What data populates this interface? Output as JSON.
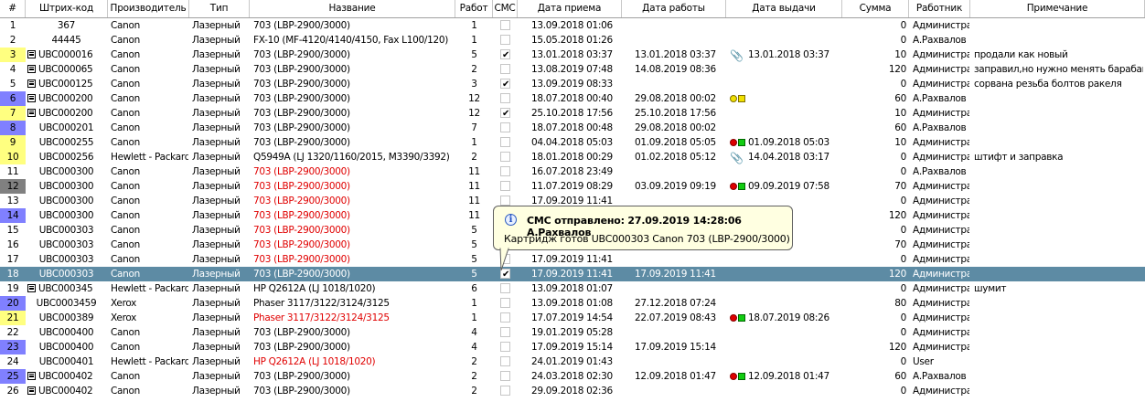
{
  "columns": [
    "#",
    "Штрих-код",
    "Производитель",
    "Тип",
    "Название",
    "Работ",
    "СМС",
    "Дата приема",
    "Дата работы",
    "Дата выдачи",
    "Сумма",
    "Работник",
    "Примечание"
  ],
  "colors": {
    "selected_row": "#5d8ba4",
    "num_yellow": "#ffff80",
    "num_blue": "#8080ff",
    "num_gray": "#808080",
    "red_text": "#e00000",
    "tooltip_bg": "#ffffe1"
  },
  "rows": [
    {
      "num": "1",
      "numbg": "",
      "tree": false,
      "barcode": "367",
      "maker": "Canon",
      "type": "Лазерный",
      "name": "703 (LBP-2900/3000)",
      "red": false,
      "work": "1",
      "sms": false,
      "received": "13.09.2018 01:06",
      "workdate": "",
      "status": "",
      "issued": "",
      "sum": "0",
      "worker": "Администра",
      "note": ""
    },
    {
      "num": "2",
      "numbg": "",
      "tree": false,
      "barcode": "44445",
      "maker": "Canon",
      "type": "Лазерный",
      "name": "FX-10 (MF-4120/4140/4150, Fax L100/120)",
      "red": false,
      "work": "1",
      "sms": false,
      "received": "15.05.2018 01:26",
      "workdate": "",
      "status": "",
      "issued": "",
      "sum": "0",
      "worker": "А.Рахвалов",
      "note": ""
    },
    {
      "num": "3",
      "numbg": "yellow",
      "tree": true,
      "barcode": "UBC000016",
      "maker": "Canon",
      "type": "Лазерный",
      "name": "703 (LBP-2900/3000)",
      "red": false,
      "work": "5",
      "sms": true,
      "received": "13.01.2018 03:37",
      "workdate": "13.01.2018 03:37",
      "status": "clip",
      "issued": "13.01.2018 03:37",
      "sum": "10",
      "worker": "Администра",
      "note": "продали как новый"
    },
    {
      "num": "4",
      "numbg": "",
      "tree": true,
      "barcode": "UBC000065",
      "maker": "Canon",
      "type": "Лазерный",
      "name": "703 (LBP-2900/3000)",
      "red": false,
      "work": "2",
      "sms": false,
      "received": "13.08.2019 07:48",
      "workdate": "14.08.2019 08:36",
      "status": "",
      "issued": "",
      "sum": "120",
      "worker": "Администра",
      "note": "заправил,но нужно менять барабан"
    },
    {
      "num": "5",
      "numbg": "",
      "tree": true,
      "barcode": "UBC000125",
      "maker": "Canon",
      "type": "Лазерный",
      "name": "703 (LBP-2900/3000)",
      "red": false,
      "work": "3",
      "sms": true,
      "received": "13.09.2019 08:33",
      "workdate": "",
      "status": "",
      "issued": "",
      "sum": "0",
      "worker": "Администра",
      "note": "сорвана резьба болтов ракеля"
    },
    {
      "num": "6",
      "numbg": "blue",
      "tree": true,
      "barcode": "UBC000200",
      "maker": "Canon",
      "type": "Лазерный",
      "name": "703 (LBP-2900/3000)",
      "red": false,
      "work": "12",
      "sms": false,
      "received": "18.07.2018 00:40",
      "workdate": "29.08.2018 00:02",
      "status": "yy",
      "issued": "",
      "sum": "60",
      "worker": "А.Рахвалов",
      "note": ""
    },
    {
      "num": "7",
      "numbg": "yellow",
      "tree": true,
      "barcode": "UBC000200",
      "maker": "Canon",
      "type": "Лазерный",
      "name": "703 (LBP-2900/3000)",
      "red": false,
      "work": "12",
      "sms": true,
      "received": "25.10.2018 17:56",
      "workdate": "25.10.2018 17:56",
      "status": "",
      "issued": "",
      "sum": "10",
      "worker": "Администра",
      "note": ""
    },
    {
      "num": "8",
      "numbg": "blue",
      "tree": false,
      "barcode": "UBC000201",
      "maker": "Canon",
      "type": "Лазерный",
      "name": "703 (LBP-2900/3000)",
      "red": false,
      "work": "7",
      "sms": false,
      "received": "18.07.2018 00:48",
      "workdate": "29.08.2018 00:02",
      "status": "",
      "issued": "",
      "sum": "60",
      "worker": "А.Рахвалов",
      "note": ""
    },
    {
      "num": "9",
      "numbg": "yellow",
      "tree": false,
      "barcode": "UBC000255",
      "maker": "Canon",
      "type": "Лазерный",
      "name": "703 (LBP-2900/3000)",
      "red": false,
      "work": "1",
      "sms": false,
      "received": "04.04.2018 05:03",
      "workdate": "01.09.2018 05:05",
      "status": "rg",
      "issued": "01.09.2018 05:03",
      "sum": "10",
      "worker": "Администра",
      "note": ""
    },
    {
      "num": "10",
      "numbg": "yellow",
      "tree": false,
      "barcode": "UBC000256",
      "maker": "Hewlett - Packard",
      "type": "Лазерный",
      "name": "Q5949A (LJ 1320/1160/2015, M3390/3392)",
      "red": false,
      "work": "2",
      "sms": false,
      "received": "18.01.2018 00:29",
      "workdate": "01.02.2018 05:12",
      "status": "clip",
      "issued": "14.04.2018 03:17",
      "sum": "0",
      "worker": "Администра",
      "note": "штифт и заправка"
    },
    {
      "num": "11",
      "numbg": "",
      "tree": false,
      "barcode": "UBC000300",
      "maker": "Canon",
      "type": "Лазерный",
      "name": "703 (LBP-2900/3000)",
      "red": true,
      "work": "11",
      "sms": false,
      "received": "16.07.2018 23:49",
      "workdate": "",
      "status": "",
      "issued": "",
      "sum": "0",
      "worker": "А.Рахвалов",
      "note": ""
    },
    {
      "num": "12",
      "numbg": "gray",
      "tree": false,
      "barcode": "UBC000300",
      "maker": "Canon",
      "type": "Лазерный",
      "name": "703 (LBP-2900/3000)",
      "red": true,
      "work": "11",
      "sms": false,
      "received": "11.07.2019 08:29",
      "workdate": "03.09.2019 09:19",
      "status": "rg",
      "issued": "09.09.2019 07:58",
      "sum": "70",
      "worker": "Администра",
      "note": ""
    },
    {
      "num": "13",
      "numbg": "",
      "tree": false,
      "barcode": "UBC000300",
      "maker": "Canon",
      "type": "Лазерный",
      "name": "703 (LBP-2900/3000)",
      "red": true,
      "work": "11",
      "sms": false,
      "received": "17.09.2019 11:41",
      "workdate": "",
      "status": "",
      "issued": "",
      "sum": "0",
      "worker": "Администра",
      "note": ""
    },
    {
      "num": "14",
      "numbg": "blue",
      "tree": false,
      "barcode": "UBC000300",
      "maker": "Canon",
      "type": "Лазерный",
      "name": "703 (LBP-2900/3000)",
      "red": true,
      "work": "11",
      "sms": false,
      "received": "",
      "workdate": "",
      "status": "",
      "issued": "",
      "sum": "120",
      "worker": "Администра",
      "note": ""
    },
    {
      "num": "15",
      "numbg": "",
      "tree": false,
      "barcode": "UBC000303",
      "maker": "Canon",
      "type": "Лазерный",
      "name": "703 (LBP-2900/3000)",
      "red": true,
      "work": "5",
      "sms": false,
      "received": "",
      "workdate": "",
      "status": "",
      "issued": "",
      "sum": "0",
      "worker": "Администра",
      "note": ""
    },
    {
      "num": "16",
      "numbg": "",
      "tree": false,
      "barcode": "UBC000303",
      "maker": "Canon",
      "type": "Лазерный",
      "name": "703 (LBP-2900/3000)",
      "red": true,
      "work": "5",
      "sms": false,
      "received": "",
      "workdate": "",
      "status": "",
      "issued": "9 07:58",
      "sum": "70",
      "worker": "Администра",
      "note": ""
    },
    {
      "num": "17",
      "numbg": "",
      "tree": false,
      "barcode": "UBC000303",
      "maker": "Canon",
      "type": "Лазерный",
      "name": "703 (LBP-2900/3000)",
      "red": true,
      "work": "5",
      "sms": false,
      "received": "17.09.2019 11:41",
      "workdate": "",
      "status": "",
      "issued": "",
      "sum": "0",
      "worker": "Администра",
      "note": ""
    },
    {
      "num": "18",
      "numbg": "",
      "tree": false,
      "barcode": "UBC000303",
      "maker": "Canon",
      "type": "Лазерный",
      "name": "703 (LBP-2900/3000)",
      "red": false,
      "work": "5",
      "sms": true,
      "received": "17.09.2019 11:41",
      "workdate": "17.09.2019 11:41",
      "status": "",
      "issued": "",
      "sum": "120",
      "worker": "Администра",
      "note": "",
      "selected": true
    },
    {
      "num": "19",
      "numbg": "",
      "tree": true,
      "barcode": "UBC000345",
      "maker": "Hewlett - Packard",
      "type": "Лазерный",
      "name": "HP Q2612A (LJ 1018/1020)",
      "red": false,
      "work": "6",
      "sms": false,
      "received": "13.09.2018 01:07",
      "workdate": "",
      "status": "",
      "issued": "",
      "sum": "0",
      "worker": "Администра",
      "note": "шумит"
    },
    {
      "num": "20",
      "numbg": "blue",
      "tree": false,
      "barcode": "UBC0003459",
      "maker": "Xerox",
      "type": "Лазерный",
      "name": "Phaser 3117/3122/3124/3125",
      "red": false,
      "work": "1",
      "sms": false,
      "received": "13.09.2018 01:08",
      "workdate": "27.12.2018 07:24",
      "status": "",
      "issued": "",
      "sum": "80",
      "worker": "Администра",
      "note": ""
    },
    {
      "num": "21",
      "numbg": "yellow",
      "tree": false,
      "barcode": "UBC000389",
      "maker": "Xerox",
      "type": "Лазерный",
      "name": "Phaser 3117/3122/3124/3125",
      "red": true,
      "work": "1",
      "sms": false,
      "received": "17.07.2019 14:54",
      "workdate": "22.07.2019 08:43",
      "status": "rg",
      "issued": "18.07.2019 08:26",
      "sum": "0",
      "worker": "Администра",
      "note": ""
    },
    {
      "num": "22",
      "numbg": "",
      "tree": false,
      "barcode": "UBC000400",
      "maker": "Canon",
      "type": "Лазерный",
      "name": "703 (LBP-2900/3000)",
      "red": false,
      "work": "4",
      "sms": false,
      "received": "19.01.2019 05:28",
      "workdate": "",
      "status": "",
      "issued": "",
      "sum": "0",
      "worker": "Администра",
      "note": ""
    },
    {
      "num": "23",
      "numbg": "blue",
      "tree": false,
      "barcode": "UBC000400",
      "maker": "Canon",
      "type": "Лазерный",
      "name": "703 (LBP-2900/3000)",
      "red": false,
      "work": "4",
      "sms": false,
      "received": "17.09.2019 15:14",
      "workdate": "17.09.2019 15:14",
      "status": "",
      "issued": "",
      "sum": "120",
      "worker": "Администра",
      "note": ""
    },
    {
      "num": "24",
      "numbg": "",
      "tree": false,
      "barcode": "UBC000401",
      "maker": "Hewlett - Packard",
      "type": "Лазерный",
      "name": "HP Q2612A (LJ 1018/1020)",
      "red": true,
      "work": "2",
      "sms": false,
      "received": "24.01.2019 01:43",
      "workdate": "",
      "status": "",
      "issued": "",
      "sum": "0",
      "worker": "User",
      "note": ""
    },
    {
      "num": "25",
      "numbg": "blue",
      "tree": true,
      "barcode": "UBC000402",
      "maker": "Canon",
      "type": "Лазерный",
      "name": "703 (LBP-2900/3000)",
      "red": false,
      "work": "2",
      "sms": false,
      "received": "24.03.2018 02:30",
      "workdate": "12.09.2018 01:47",
      "status": "rg",
      "issued": "12.09.2018 01:47",
      "sum": "60",
      "worker": "А.Рахвалов",
      "note": ""
    },
    {
      "num": "26",
      "numbg": "",
      "tree": true,
      "barcode": "UBC000402",
      "maker": "Canon",
      "type": "Лазерный",
      "name": "703 (LBP-2900/3000)",
      "red": false,
      "work": "2",
      "sms": false,
      "received": "29.09.2018 02:36",
      "workdate": "",
      "status": "",
      "issued": "",
      "sum": "0",
      "worker": "Администра",
      "note": ""
    }
  ],
  "tooltip": {
    "title": "СМС отправлено: 27.09.2019 14:28:06 А.Рахвалов",
    "body": "Картридж готов UBC000303 Canon 703 (LBP-2900/3000)",
    "icon": "info-icon"
  }
}
